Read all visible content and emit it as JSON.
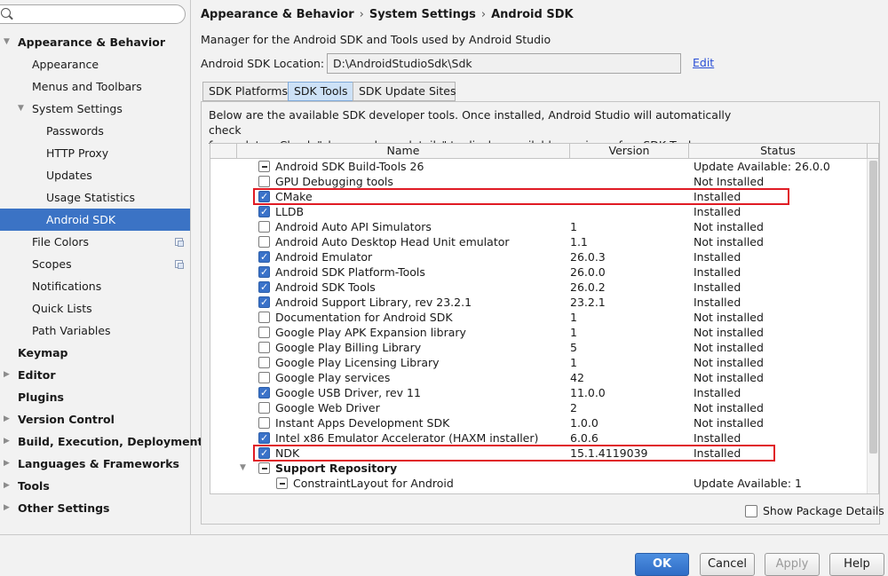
{
  "search": {
    "value": "",
    "placeholder": ""
  },
  "sidebar": {
    "items": [
      {
        "label": "Appearance & Behavior",
        "level": 0,
        "bold": true,
        "expanded": true
      },
      {
        "label": "Appearance",
        "level": 1
      },
      {
        "label": "Menus and Toolbars",
        "level": 1
      },
      {
        "label": "System Settings",
        "level": 1,
        "expanded": true
      },
      {
        "label": "Passwords",
        "level": 2
      },
      {
        "label": "HTTP Proxy",
        "level": 2
      },
      {
        "label": "Updates",
        "level": 2
      },
      {
        "label": "Usage Statistics",
        "level": 2
      },
      {
        "label": "Android SDK",
        "level": 2,
        "selected": true
      },
      {
        "label": "File Colors",
        "level": 1,
        "copy_icon": true
      },
      {
        "label": "Scopes",
        "level": 1,
        "copy_icon": true
      },
      {
        "label": "Notifications",
        "level": 1
      },
      {
        "label": "Quick Lists",
        "level": 1
      },
      {
        "label": "Path Variables",
        "level": 1
      },
      {
        "label": "Keymap",
        "level": 0,
        "bold": true
      },
      {
        "label": "Editor",
        "level": 0,
        "bold": true,
        "collapsed": true
      },
      {
        "label": "Plugins",
        "level": 0,
        "bold": true
      },
      {
        "label": "Version Control",
        "level": 0,
        "bold": true,
        "collapsed": true
      },
      {
        "label": "Build, Execution, Deployment",
        "level": 0,
        "bold": true,
        "collapsed": true
      },
      {
        "label": "Languages & Frameworks",
        "level": 0,
        "bold": true,
        "collapsed": true
      },
      {
        "label": "Tools",
        "level": 0,
        "bold": true,
        "collapsed": true
      },
      {
        "label": "Other Settings",
        "level": 0,
        "bold": true,
        "collapsed": true
      }
    ]
  },
  "header": {
    "crumbs": [
      "Appearance & Behavior",
      "System Settings",
      "Android SDK"
    ],
    "separator": "›",
    "description": "Manager for the Android SDK and Tools used by Android Studio",
    "location_label": "Android SDK Location:",
    "location_value": "D:\\AndroidStudioSdk\\Sdk",
    "edit_label": "Edit"
  },
  "tabs": [
    {
      "label": "SDK Platforms",
      "active": false
    },
    {
      "label": "SDK Tools",
      "active": true
    },
    {
      "label": "SDK Update Sites",
      "active": false
    }
  ],
  "panel": {
    "desc_line1": "Below are the available SDK developer tools. Once installed, Android Studio will automatically check",
    "desc_line2": "for updates. Check \"show package details\" to display available versions of an SDK Tool.",
    "show_details_label": "Show Package Details",
    "show_details_checked": false
  },
  "table": {
    "columns": [
      "Name",
      "Version",
      "Status"
    ],
    "rows": [
      {
        "name": "Android SDK Build-Tools 26",
        "version": "",
        "status": "Update Available: 26.0.0",
        "check": "partial"
      },
      {
        "name": "GPU Debugging tools",
        "version": "",
        "status": "Not Installed",
        "check": "unchecked"
      },
      {
        "name": "CMake",
        "version": "",
        "status": "Installed",
        "check": "checked",
        "highlight": true
      },
      {
        "name": "LLDB",
        "version": "",
        "status": "Installed",
        "check": "checked"
      },
      {
        "name": "Android Auto API Simulators",
        "version": "1",
        "status": "Not installed",
        "check": "unchecked"
      },
      {
        "name": "Android Auto Desktop Head Unit emulator",
        "version": "1.1",
        "status": "Not installed",
        "check": "unchecked"
      },
      {
        "name": "Android Emulator",
        "version": "26.0.3",
        "status": "Installed",
        "check": "checked"
      },
      {
        "name": "Android SDK Platform-Tools",
        "version": "26.0.0",
        "status": "Installed",
        "check": "checked"
      },
      {
        "name": "Android SDK Tools",
        "version": "26.0.2",
        "status": "Installed",
        "check": "checked"
      },
      {
        "name": "Android Support Library, rev 23.2.1",
        "version": "23.2.1",
        "status": "Installed",
        "check": "checked"
      },
      {
        "name": "Documentation for Android SDK",
        "version": "1",
        "status": "Not installed",
        "check": "unchecked"
      },
      {
        "name": "Google Play APK Expansion library",
        "version": "1",
        "status": "Not installed",
        "check": "unchecked"
      },
      {
        "name": "Google Play Billing Library",
        "version": "5",
        "status": "Not installed",
        "check": "unchecked"
      },
      {
        "name": "Google Play Licensing Library",
        "version": "1",
        "status": "Not installed",
        "check": "unchecked"
      },
      {
        "name": "Google Play services",
        "version": "42",
        "status": "Not installed",
        "check": "unchecked"
      },
      {
        "name": "Google USB Driver, rev 11",
        "version": "11.0.0",
        "status": "Installed",
        "check": "checked"
      },
      {
        "name": "Google Web Driver",
        "version": "2",
        "status": "Not installed",
        "check": "unchecked"
      },
      {
        "name": "Instant Apps Development SDK",
        "version": "1.0.0",
        "status": "Not installed",
        "check": "unchecked"
      },
      {
        "name": "Intel x86 Emulator Accelerator (HAXM installer)",
        "version": "6.0.6",
        "status": "Installed",
        "check": "checked"
      },
      {
        "name": "NDK",
        "version": "15.1.4119039",
        "status": "Installed",
        "check": "checked",
        "highlight": true
      },
      {
        "name": "Support Repository",
        "version": "",
        "status": "",
        "check": "partial",
        "group": true
      },
      {
        "name": "ConstraintLayout for Android",
        "version": "",
        "status": "Update Available: 1",
        "check": "partial",
        "indent": true
      }
    ]
  },
  "buttons": {
    "ok": "OK",
    "cancel": "Cancel",
    "apply": "Apply",
    "help": "Help"
  },
  "colors": {
    "selection": "#3b73c5",
    "highlight": "#e01b24",
    "checkbox": "#3a72c9",
    "link": "#2a4fd6"
  }
}
